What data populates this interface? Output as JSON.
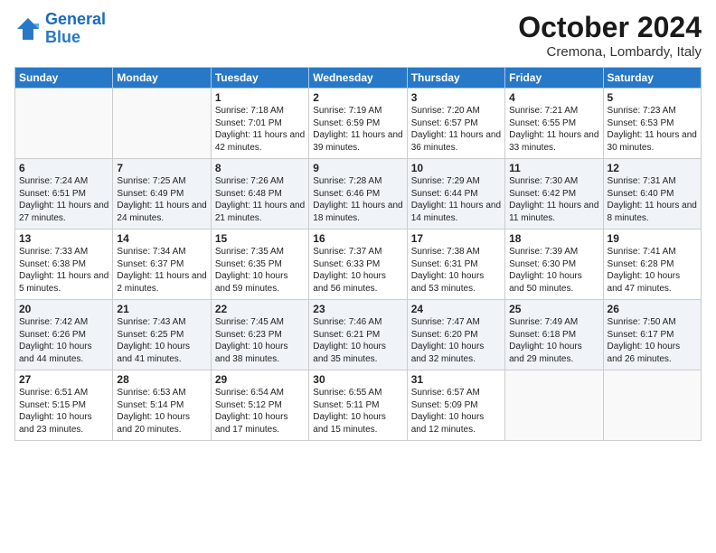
{
  "header": {
    "logo_line1": "General",
    "logo_line2": "Blue",
    "month": "October 2024",
    "location": "Cremona, Lombardy, Italy"
  },
  "weekdays": [
    "Sunday",
    "Monday",
    "Tuesday",
    "Wednesday",
    "Thursday",
    "Friday",
    "Saturday"
  ],
  "rows": [
    [
      {
        "day": "",
        "content": ""
      },
      {
        "day": "",
        "content": ""
      },
      {
        "day": "1",
        "content": "Sunrise: 7:18 AM\nSunset: 7:01 PM\nDaylight: 11 hours and 42 minutes."
      },
      {
        "day": "2",
        "content": "Sunrise: 7:19 AM\nSunset: 6:59 PM\nDaylight: 11 hours and 39 minutes."
      },
      {
        "day": "3",
        "content": "Sunrise: 7:20 AM\nSunset: 6:57 PM\nDaylight: 11 hours and 36 minutes."
      },
      {
        "day": "4",
        "content": "Sunrise: 7:21 AM\nSunset: 6:55 PM\nDaylight: 11 hours and 33 minutes."
      },
      {
        "day": "5",
        "content": "Sunrise: 7:23 AM\nSunset: 6:53 PM\nDaylight: 11 hours and 30 minutes."
      }
    ],
    [
      {
        "day": "6",
        "content": "Sunrise: 7:24 AM\nSunset: 6:51 PM\nDaylight: 11 hours and 27 minutes."
      },
      {
        "day": "7",
        "content": "Sunrise: 7:25 AM\nSunset: 6:49 PM\nDaylight: 11 hours and 24 minutes."
      },
      {
        "day": "8",
        "content": "Sunrise: 7:26 AM\nSunset: 6:48 PM\nDaylight: 11 hours and 21 minutes."
      },
      {
        "day": "9",
        "content": "Sunrise: 7:28 AM\nSunset: 6:46 PM\nDaylight: 11 hours and 18 minutes."
      },
      {
        "day": "10",
        "content": "Sunrise: 7:29 AM\nSunset: 6:44 PM\nDaylight: 11 hours and 14 minutes."
      },
      {
        "day": "11",
        "content": "Sunrise: 7:30 AM\nSunset: 6:42 PM\nDaylight: 11 hours and 11 minutes."
      },
      {
        "day": "12",
        "content": "Sunrise: 7:31 AM\nSunset: 6:40 PM\nDaylight: 11 hours and 8 minutes."
      }
    ],
    [
      {
        "day": "13",
        "content": "Sunrise: 7:33 AM\nSunset: 6:38 PM\nDaylight: 11 hours and 5 minutes."
      },
      {
        "day": "14",
        "content": "Sunrise: 7:34 AM\nSunset: 6:37 PM\nDaylight: 11 hours and 2 minutes."
      },
      {
        "day": "15",
        "content": "Sunrise: 7:35 AM\nSunset: 6:35 PM\nDaylight: 10 hours and 59 minutes."
      },
      {
        "day": "16",
        "content": "Sunrise: 7:37 AM\nSunset: 6:33 PM\nDaylight: 10 hours and 56 minutes."
      },
      {
        "day": "17",
        "content": "Sunrise: 7:38 AM\nSunset: 6:31 PM\nDaylight: 10 hours and 53 minutes."
      },
      {
        "day": "18",
        "content": "Sunrise: 7:39 AM\nSunset: 6:30 PM\nDaylight: 10 hours and 50 minutes."
      },
      {
        "day": "19",
        "content": "Sunrise: 7:41 AM\nSunset: 6:28 PM\nDaylight: 10 hours and 47 minutes."
      }
    ],
    [
      {
        "day": "20",
        "content": "Sunrise: 7:42 AM\nSunset: 6:26 PM\nDaylight: 10 hours and 44 minutes."
      },
      {
        "day": "21",
        "content": "Sunrise: 7:43 AM\nSunset: 6:25 PM\nDaylight: 10 hours and 41 minutes."
      },
      {
        "day": "22",
        "content": "Sunrise: 7:45 AM\nSunset: 6:23 PM\nDaylight: 10 hours and 38 minutes."
      },
      {
        "day": "23",
        "content": "Sunrise: 7:46 AM\nSunset: 6:21 PM\nDaylight: 10 hours and 35 minutes."
      },
      {
        "day": "24",
        "content": "Sunrise: 7:47 AM\nSunset: 6:20 PM\nDaylight: 10 hours and 32 minutes."
      },
      {
        "day": "25",
        "content": "Sunrise: 7:49 AM\nSunset: 6:18 PM\nDaylight: 10 hours and 29 minutes."
      },
      {
        "day": "26",
        "content": "Sunrise: 7:50 AM\nSunset: 6:17 PM\nDaylight: 10 hours and 26 minutes."
      }
    ],
    [
      {
        "day": "27",
        "content": "Sunrise: 6:51 AM\nSunset: 5:15 PM\nDaylight: 10 hours and 23 minutes."
      },
      {
        "day": "28",
        "content": "Sunrise: 6:53 AM\nSunset: 5:14 PM\nDaylight: 10 hours and 20 minutes."
      },
      {
        "day": "29",
        "content": "Sunrise: 6:54 AM\nSunset: 5:12 PM\nDaylight: 10 hours and 17 minutes."
      },
      {
        "day": "30",
        "content": "Sunrise: 6:55 AM\nSunset: 5:11 PM\nDaylight: 10 hours and 15 minutes."
      },
      {
        "day": "31",
        "content": "Sunrise: 6:57 AM\nSunset: 5:09 PM\nDaylight: 10 hours and 12 minutes."
      },
      {
        "day": "",
        "content": ""
      },
      {
        "day": "",
        "content": ""
      }
    ]
  ]
}
